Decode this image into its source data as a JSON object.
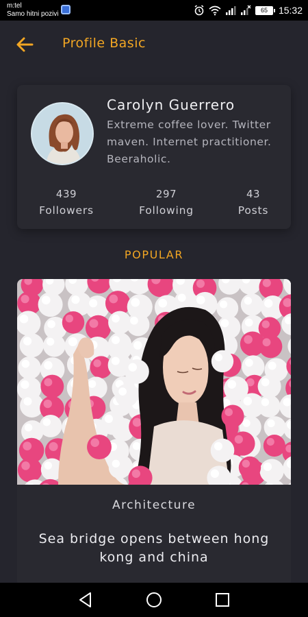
{
  "status_bar": {
    "carrier": "m:tel",
    "network_message": "Samo hitni pozivi",
    "battery": "65",
    "time": "15:32"
  },
  "header": {
    "title": "Profile Basic",
    "back_icon": "arrow-left-icon"
  },
  "profile": {
    "name": "Carolyn Guerrero",
    "bio": "Extreme coffee lover. Twitter maven. Internet practitioner. Beeraholic.",
    "stats": [
      {
        "value": "439",
        "label": "Followers"
      },
      {
        "value": "297",
        "label": "Following"
      },
      {
        "value": "43",
        "label": "Posts"
      }
    ]
  },
  "section": {
    "label": "POPULAR"
  },
  "post": {
    "category": "Architecture",
    "title": "Sea bridge opens between hong kong and china"
  },
  "colors": {
    "accent": "#f2a623",
    "background": "#25252d",
    "card": "#292930"
  }
}
